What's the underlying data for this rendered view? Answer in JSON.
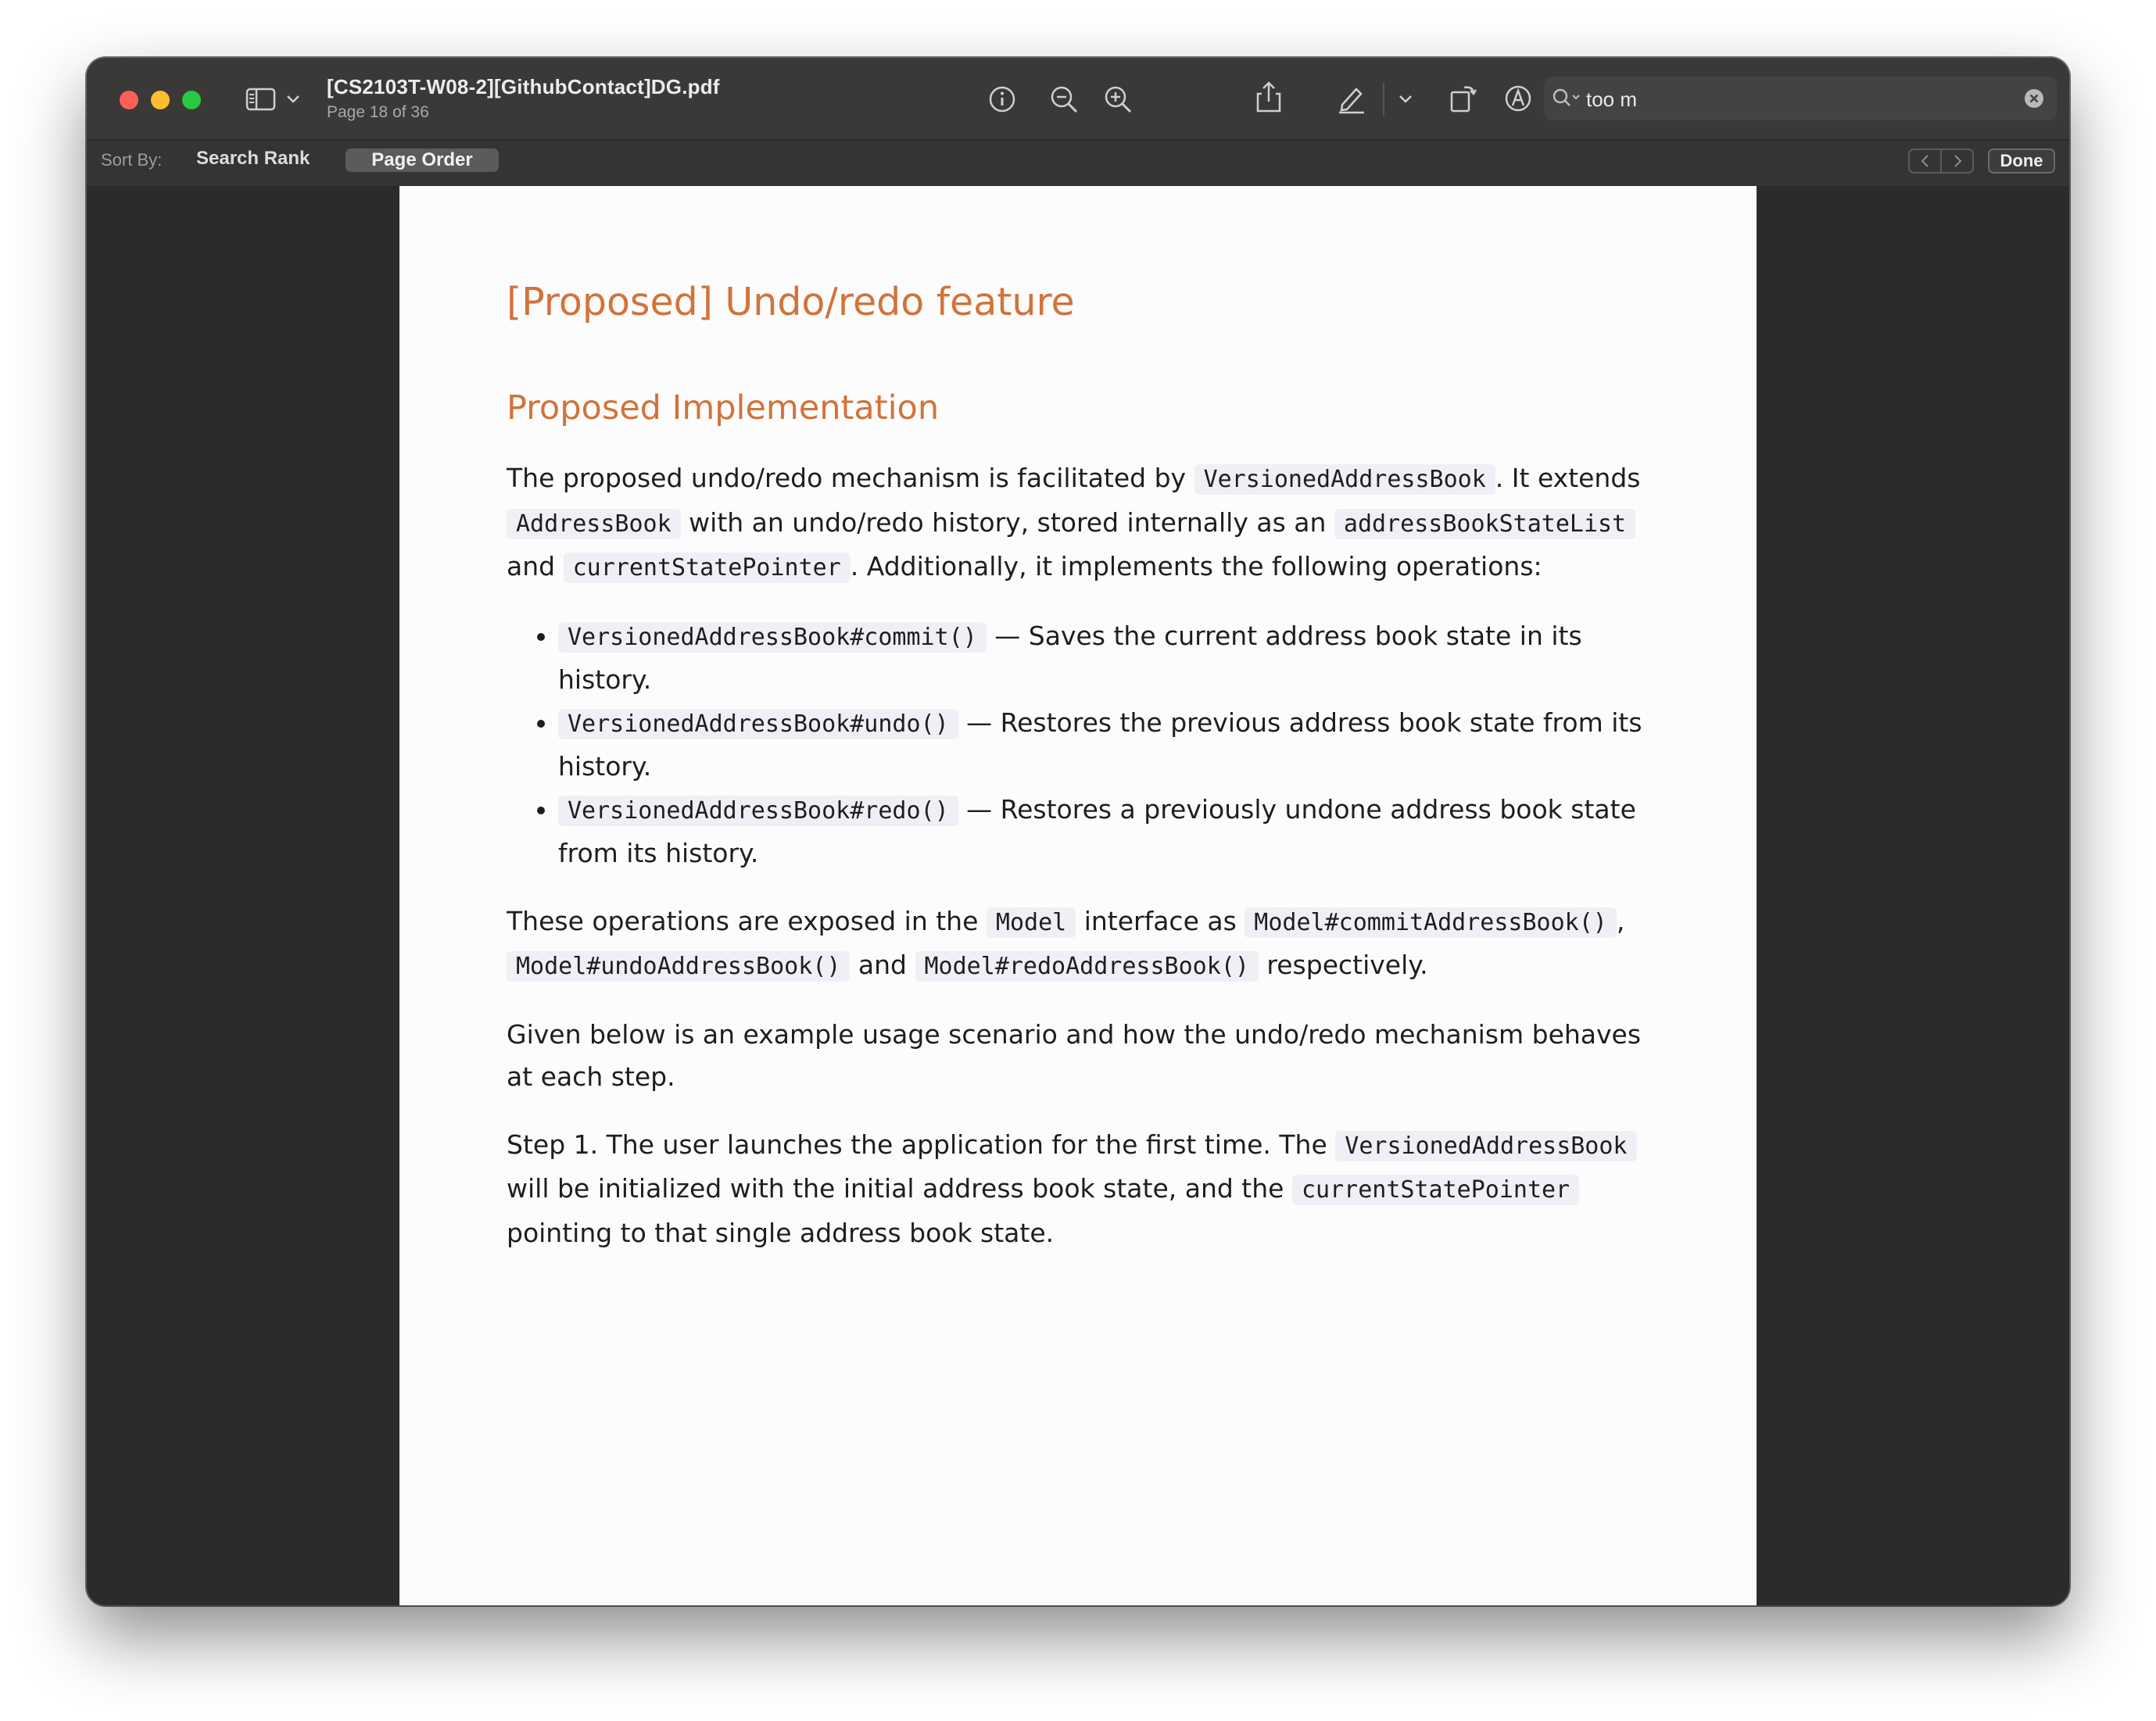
{
  "titlebar": {
    "doc_title": "[CS2103T-W08-2][GithubContact]DG.pdf",
    "page_info": "Page 18 of 36"
  },
  "toolbar_icons": [
    "sidebar-icon",
    "chevron-down-icon",
    "info-icon",
    "zoom-out-icon",
    "zoom-in-icon",
    "share-icon",
    "highlight-pen-icon",
    "chevron-down-icon",
    "rotate-icon",
    "markup-icon",
    "form-fill-icon"
  ],
  "search": {
    "value": "too m"
  },
  "sortbar": {
    "label": "Sort By:",
    "search_rank": "Search Rank",
    "page_order": "Page Order",
    "done": "Done"
  },
  "document": {
    "heading": "[Proposed] Undo/redo feature",
    "subheading": "Proposed Implementation",
    "p1": {
      "t1": "The proposed undo/redo mechanism is facilitated by ",
      "c1": "VersionedAddressBook",
      "t2": ". It extends ",
      "c2": "AddressBook",
      "t3": " with an undo/redo history, stored internally as an ",
      "c3": "addressBookStateList",
      "t4": " and ",
      "c4": "currentStatePointer",
      "t5": ". Additionally, it implements the following operations:"
    },
    "bullets": [
      {
        "code": "VersionedAddressBook#commit()",
        "text": " — Saves the current address book state in its history."
      },
      {
        "code": "VersionedAddressBook#undo()",
        "text": " — Restores the previous address book state from its history."
      },
      {
        "code": "VersionedAddressBook#redo()",
        "text": " — Restores a previously undone address book state from its history."
      }
    ],
    "p2": {
      "t1": "These operations are exposed in the ",
      "c1": "Model",
      "t2": " interface as ",
      "c2": "Model#commitAddressBook()",
      "t3": ", ",
      "c3": "Model#undoAddressBook()",
      "t4": " and ",
      "c4": "Model#redoAddressBook()",
      "t5": " respectively."
    },
    "p3": "Given below is an example usage scenario and how the undo/redo mechanism behaves at each step.",
    "p4": {
      "t1": "Step 1. The user launches the application for the first time. The ",
      "c1": "VersionedAddressBook",
      "t2": " will be initialized with the initial address book state, and the ",
      "c2": "currentStatePointer",
      "t3": " pointing to that single address book state."
    }
  },
  "colors": {
    "heading": "#d2733a",
    "titlebar": "#3b3938",
    "close": "#fe5f57",
    "minimize": "#febc2e",
    "maximize": "#28c840"
  }
}
